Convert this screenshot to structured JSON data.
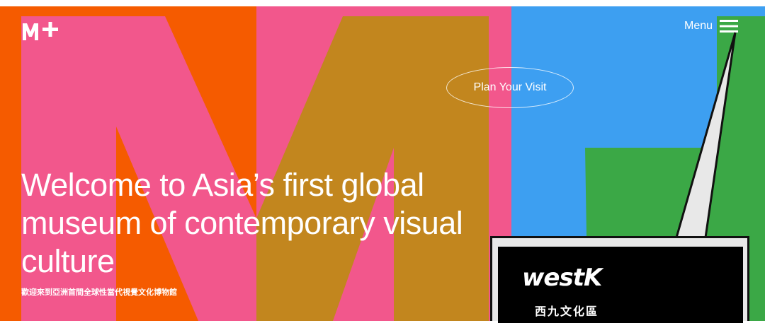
{
  "header": {
    "logo_text": "M+",
    "menu_label": "Menu"
  },
  "hero": {
    "cta_label": "Plan Your Visit",
    "headline": "Welcome to Asia’s first global museum of contemporary visual culture",
    "subheadline": "歡迎來到亞洲首間全球性當代視覺文化博物館"
  },
  "callout": {
    "logo_text": "westK",
    "subtitle": "西九文化區"
  },
  "colors": {
    "orange": "#F55B00",
    "pink": "#F2578C",
    "mustard": "#C2861E",
    "blue": "#3D9FF1",
    "green": "#3BA846",
    "white": "#FFFFFF"
  }
}
